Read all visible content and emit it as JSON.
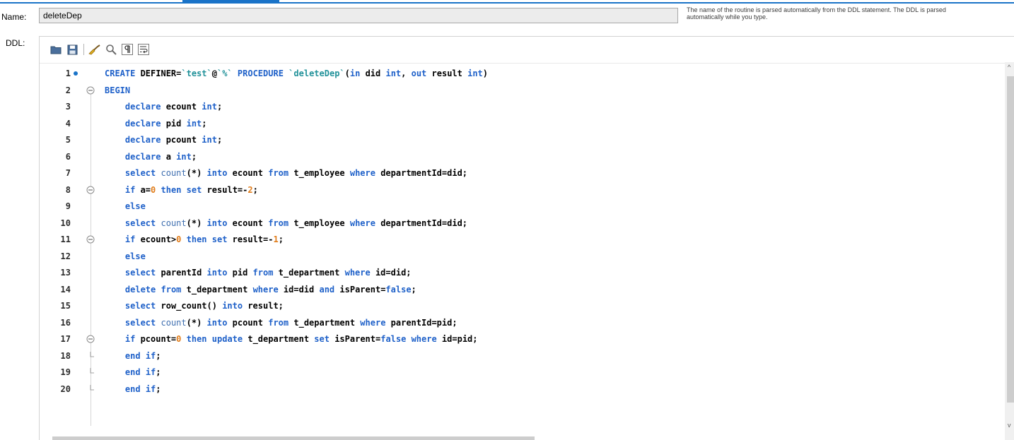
{
  "form": {
    "name_label": "Name:",
    "name_value": "deleteDep",
    "hint": "The name of the routine is parsed automatically from the DDL statement. The DDL is parsed automatically while you type.",
    "ddl_label": "DDL:"
  },
  "toolbar": {
    "buttons": [
      "open-file",
      "save-file",
      "beautify",
      "find",
      "toggle-invisible-chars",
      "toggle-word-wrap"
    ]
  },
  "colors": {
    "accent": "#1a73c8",
    "keyword": "#1f61c9",
    "function": "#3f6fb0",
    "string": "#22929a",
    "number": "#e07c1a"
  },
  "code": {
    "lines": [
      {
        "num": "1",
        "bp": true,
        "fold": "",
        "tokens": [
          [
            "k",
            "CREATE"
          ],
          [
            "p",
            " DEFINER="
          ],
          [
            "s",
            "`test`"
          ],
          [
            "p",
            "@"
          ],
          [
            "s",
            "`%`"
          ],
          [
            "p",
            " "
          ],
          [
            "k",
            "PROCEDURE"
          ],
          [
            "p",
            " "
          ],
          [
            "s",
            "`deleteDep`"
          ],
          [
            "p",
            "("
          ],
          [
            "k",
            "in"
          ],
          [
            "p",
            " did "
          ],
          [
            "k",
            "int"
          ],
          [
            "p",
            ", "
          ],
          [
            "k",
            "out"
          ],
          [
            "p",
            " result "
          ],
          [
            "k",
            "int"
          ],
          [
            "p",
            ")"
          ]
        ]
      },
      {
        "num": "2",
        "bp": false,
        "fold": "open",
        "tokens": [
          [
            "k",
            "BEGIN"
          ]
        ]
      },
      {
        "num": "3",
        "bp": false,
        "fold": "",
        "tokens": [
          [
            "p",
            "    "
          ],
          [
            "k",
            "declare"
          ],
          [
            "p",
            " ecount "
          ],
          [
            "k",
            "int"
          ],
          [
            "p",
            ";"
          ]
        ]
      },
      {
        "num": "4",
        "bp": false,
        "fold": "",
        "tokens": [
          [
            "p",
            "    "
          ],
          [
            "k",
            "declare"
          ],
          [
            "p",
            " pid "
          ],
          [
            "k",
            "int"
          ],
          [
            "p",
            ";"
          ]
        ]
      },
      {
        "num": "5",
        "bp": false,
        "fold": "",
        "tokens": [
          [
            "p",
            "    "
          ],
          [
            "k",
            "declare"
          ],
          [
            "p",
            " pcount "
          ],
          [
            "k",
            "int"
          ],
          [
            "p",
            ";"
          ]
        ]
      },
      {
        "num": "6",
        "bp": false,
        "fold": "",
        "tokens": [
          [
            "p",
            "    "
          ],
          [
            "k",
            "declare"
          ],
          [
            "p",
            " a "
          ],
          [
            "k",
            "int"
          ],
          [
            "p",
            ";"
          ]
        ]
      },
      {
        "num": "7",
        "bp": false,
        "fold": "",
        "tokens": [
          [
            "p",
            "    "
          ],
          [
            "k",
            "select"
          ],
          [
            "p",
            " "
          ],
          [
            "f",
            "count"
          ],
          [
            "p",
            "(*) "
          ],
          [
            "k",
            "into"
          ],
          [
            "p",
            " ecount "
          ],
          [
            "k",
            "from"
          ],
          [
            "p",
            " t_employee "
          ],
          [
            "k",
            "where"
          ],
          [
            "p",
            " departmentId=did;"
          ]
        ]
      },
      {
        "num": "8",
        "bp": false,
        "fold": "open",
        "tokens": [
          [
            "p",
            "    "
          ],
          [
            "k",
            "if"
          ],
          [
            "p",
            " a="
          ],
          [
            "n",
            "0"
          ],
          [
            "p",
            " "
          ],
          [
            "k",
            "then"
          ],
          [
            "p",
            " "
          ],
          [
            "k",
            "set"
          ],
          [
            "p",
            " result=-"
          ],
          [
            "n",
            "2"
          ],
          [
            "p",
            ";"
          ]
        ]
      },
      {
        "num": "9",
        "bp": false,
        "fold": "",
        "tokens": [
          [
            "p",
            "    "
          ],
          [
            "k",
            "else"
          ]
        ]
      },
      {
        "num": "10",
        "bp": false,
        "fold": "",
        "tokens": [
          [
            "p",
            "    "
          ],
          [
            "k",
            "select"
          ],
          [
            "p",
            " "
          ],
          [
            "f",
            "count"
          ],
          [
            "p",
            "(*) "
          ],
          [
            "k",
            "into"
          ],
          [
            "p",
            " ecount "
          ],
          [
            "k",
            "from"
          ],
          [
            "p",
            " t_employee "
          ],
          [
            "k",
            "where"
          ],
          [
            "p",
            " departmentId=did;"
          ]
        ]
      },
      {
        "num": "11",
        "bp": false,
        "fold": "open",
        "tokens": [
          [
            "p",
            "    "
          ],
          [
            "k",
            "if"
          ],
          [
            "p",
            " ecount>"
          ],
          [
            "n",
            "0"
          ],
          [
            "p",
            " "
          ],
          [
            "k",
            "then"
          ],
          [
            "p",
            " "
          ],
          [
            "k",
            "set"
          ],
          [
            "p",
            " result=-"
          ],
          [
            "n",
            "1"
          ],
          [
            "p",
            ";"
          ]
        ]
      },
      {
        "num": "12",
        "bp": false,
        "fold": "",
        "tokens": [
          [
            "p",
            "    "
          ],
          [
            "k",
            "else"
          ]
        ]
      },
      {
        "num": "13",
        "bp": false,
        "fold": "",
        "tokens": [
          [
            "p",
            "    "
          ],
          [
            "k",
            "select"
          ],
          [
            "p",
            " parentId "
          ],
          [
            "k",
            "into"
          ],
          [
            "p",
            " pid "
          ],
          [
            "k",
            "from"
          ],
          [
            "p",
            " t_department "
          ],
          [
            "k",
            "where"
          ],
          [
            "p",
            " id=did;"
          ]
        ]
      },
      {
        "num": "14",
        "bp": false,
        "fold": "",
        "tokens": [
          [
            "p",
            "    "
          ],
          [
            "k",
            "delete"
          ],
          [
            "p",
            " "
          ],
          [
            "k",
            "from"
          ],
          [
            "p",
            " t_department "
          ],
          [
            "k",
            "where"
          ],
          [
            "p",
            " id=did "
          ],
          [
            "k",
            "and"
          ],
          [
            "p",
            " isParent="
          ],
          [
            "k",
            "false"
          ],
          [
            "p",
            ";"
          ]
        ]
      },
      {
        "num": "15",
        "bp": false,
        "fold": "",
        "tokens": [
          [
            "p",
            "    "
          ],
          [
            "k",
            "select"
          ],
          [
            "p",
            " row_count() "
          ],
          [
            "k",
            "into"
          ],
          [
            "p",
            " result;"
          ]
        ]
      },
      {
        "num": "16",
        "bp": false,
        "fold": "",
        "tokens": [
          [
            "p",
            "    "
          ],
          [
            "k",
            "select"
          ],
          [
            "p",
            " "
          ],
          [
            "f",
            "count"
          ],
          [
            "p",
            "(*) "
          ],
          [
            "k",
            "into"
          ],
          [
            "p",
            " pcount "
          ],
          [
            "k",
            "from"
          ],
          [
            "p",
            " t_department "
          ],
          [
            "k",
            "where"
          ],
          [
            "p",
            " parentId=pid;"
          ]
        ]
      },
      {
        "num": "17",
        "bp": false,
        "fold": "open",
        "tokens": [
          [
            "p",
            "    "
          ],
          [
            "k",
            "if"
          ],
          [
            "p",
            " pcount="
          ],
          [
            "n",
            "0"
          ],
          [
            "p",
            " "
          ],
          [
            "k",
            "then"
          ],
          [
            "p",
            " "
          ],
          [
            "k",
            "update"
          ],
          [
            "p",
            " t_department "
          ],
          [
            "k",
            "set"
          ],
          [
            "p",
            " isParent="
          ],
          [
            "k",
            "false"
          ],
          [
            "p",
            " "
          ],
          [
            "k",
            "where"
          ],
          [
            "p",
            " id=pid;"
          ]
        ]
      },
      {
        "num": "18",
        "bp": false,
        "fold": "end",
        "tokens": [
          [
            "p",
            "    "
          ],
          [
            "k",
            "end"
          ],
          [
            "p",
            " "
          ],
          [
            "k",
            "if"
          ],
          [
            "p",
            ";"
          ]
        ]
      },
      {
        "num": "19",
        "bp": false,
        "fold": "end",
        "tokens": [
          [
            "p",
            "    "
          ],
          [
            "k",
            "end"
          ],
          [
            "p",
            " "
          ],
          [
            "k",
            "if"
          ],
          [
            "p",
            ";"
          ]
        ]
      },
      {
        "num": "20",
        "bp": false,
        "fold": "end",
        "tokens": [
          [
            "p",
            "    "
          ],
          [
            "k",
            "end"
          ],
          [
            "p",
            " "
          ],
          [
            "k",
            "if"
          ],
          [
            "p",
            ";"
          ]
        ]
      }
    ]
  }
}
